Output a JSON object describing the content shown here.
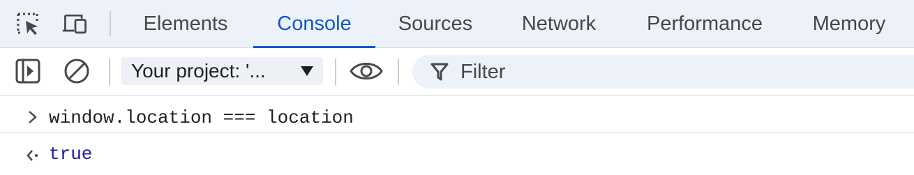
{
  "tabbar": {
    "tools": [
      "inspect-element-icon",
      "device-toolbar-icon"
    ],
    "tabs": [
      {
        "label": "Elements",
        "active": false
      },
      {
        "label": "Console",
        "active": true
      },
      {
        "label": "Sources",
        "active": false
      },
      {
        "label": "Network",
        "active": false
      },
      {
        "label": "Performance",
        "active": false
      },
      {
        "label": "Memory",
        "active": false
      }
    ]
  },
  "toolbar": {
    "context_label": "Your project: '...",
    "filter_label": "Filter"
  },
  "console": {
    "input": "window.location === location",
    "output": "true"
  },
  "colors": {
    "accent": "#0b57d0",
    "tabbar_bg": "#edf2fa",
    "result_value": "#1a1aa6"
  }
}
